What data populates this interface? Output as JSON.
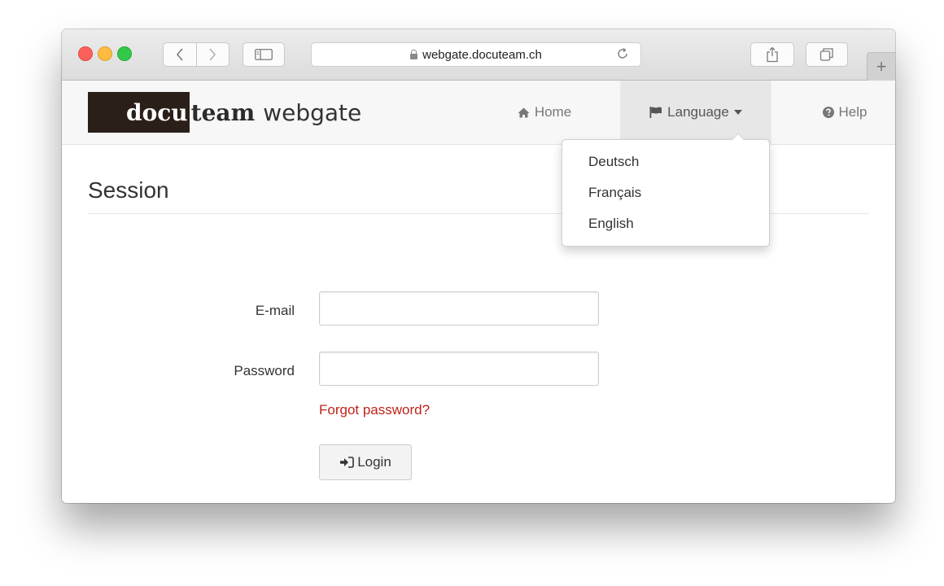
{
  "browser": {
    "url": "webgate.docuteam.ch",
    "new_tab_label": "+"
  },
  "navbar": {
    "logo_docu": "docu",
    "logo_team": "team",
    "logo_webgate": "webgate",
    "home_label": "Home",
    "language_label": "Language",
    "help_label": "Help"
  },
  "language_menu": {
    "items": [
      "Deutsch",
      "Français",
      "English"
    ]
  },
  "page": {
    "title": "Session",
    "email_label": "E-mail",
    "email_value": "",
    "password_label": "Password",
    "password_value": "",
    "forgot_link": "Forgot password?",
    "login_label": "Login"
  },
  "colors": {
    "logo_background": "#2b2019",
    "link_red": "#c0221a",
    "navbar_bg": "#f7f7f7"
  }
}
